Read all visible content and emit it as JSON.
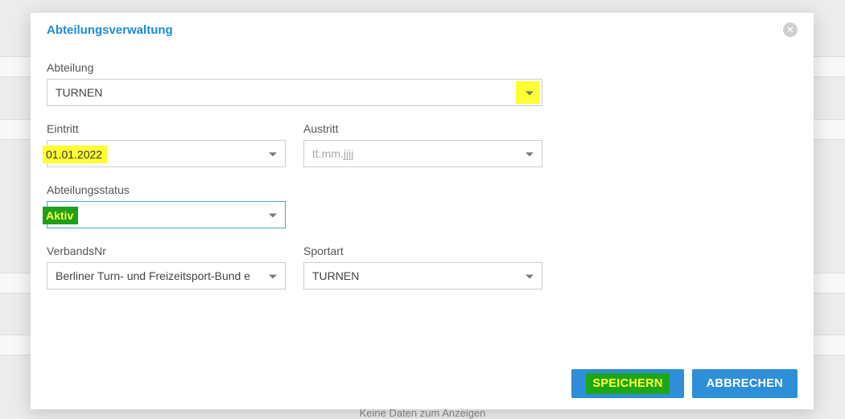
{
  "modal": {
    "title": "Abteilungsverwaltung",
    "fields": {
      "abteilung": {
        "label": "Abteilung",
        "value": "TURNEN"
      },
      "eintritt": {
        "label": "Eintritt",
        "value": "01.01.2022"
      },
      "austritt": {
        "label": "Austritt",
        "placeholder": "tt.mm.jjjj"
      },
      "status": {
        "label": "Abteilungsstatus",
        "value": "Aktiv"
      },
      "verbandsnr": {
        "label": "VerbandsNr",
        "value": "Berliner Turn- und Freizeitsport-Bund e"
      },
      "sportart": {
        "label": "Sportart",
        "value": "TURNEN"
      }
    },
    "buttons": {
      "save": "SPEICHERN",
      "cancel": "ABBRECHEN"
    }
  },
  "background_text": "Keine Daten zum Anzeigen"
}
